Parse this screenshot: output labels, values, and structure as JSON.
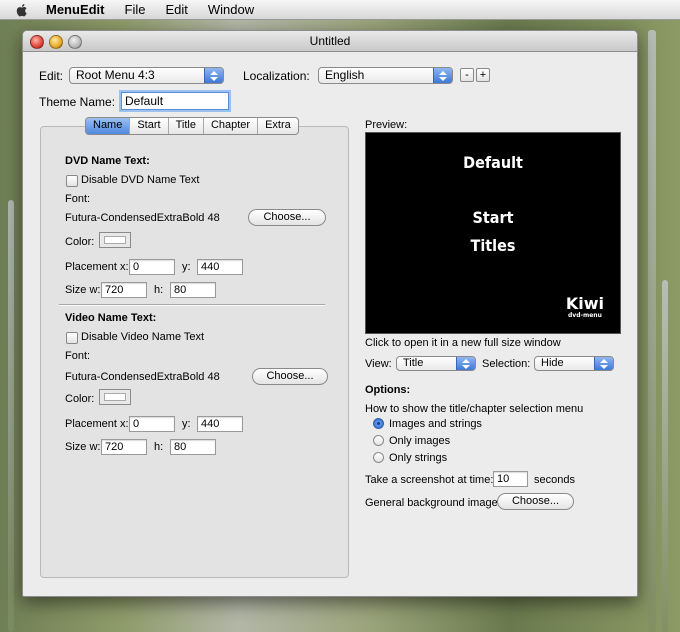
{
  "menubar": {
    "app": "MenuEdit",
    "items": [
      "File",
      "Edit",
      "Window"
    ]
  },
  "window": {
    "title": "Untitled"
  },
  "edit": {
    "label": "Edit:",
    "value": "Root Menu 4:3"
  },
  "localization": {
    "label": "Localization:",
    "value": "English",
    "minus": "-",
    "plus": "+"
  },
  "theme": {
    "label": "Theme Name:",
    "value": "Default"
  },
  "tabs": [
    {
      "label": "Name",
      "active": true
    },
    {
      "label": "Start"
    },
    {
      "label": "Title"
    },
    {
      "label": "Chapter"
    },
    {
      "label": "Extra"
    }
  ],
  "dvd": {
    "heading": "DVD Name Text:",
    "disable": "Disable DVD Name Text",
    "font_label": "Font:",
    "font": "Futura-CondensedExtraBold 48",
    "choose": "Choose...",
    "color_label": "Color:",
    "placement_label": "Placement x:",
    "x": "0",
    "y_label": "y:",
    "y": "440",
    "size_label": "Size w:",
    "w": "720",
    "h_label": "h:",
    "h": "80"
  },
  "video": {
    "heading": "Video Name Text:",
    "disable": "Disable Video Name Text",
    "font_label": "Font:",
    "font": "Futura-CondensedExtraBold 48",
    "choose": "Choose...",
    "color_label": "Color:",
    "placement_label": "Placement x:",
    "x": "0",
    "y_label": "y:",
    "y": "440",
    "size_label": "Size w:",
    "w": "720",
    "h_label": "h:",
    "h": "80"
  },
  "preview": {
    "label": "Preview:",
    "lines": [
      "Default",
      "Start",
      "Titles"
    ],
    "logo": "Kiwi",
    "logo_sub": "dvd-menu",
    "hint": "Click to open it in a new full size window"
  },
  "view": {
    "label": "View:",
    "value": "Title",
    "selection_label": "Selection:",
    "selection_value": "Hide"
  },
  "options": {
    "heading": "Options:",
    "question": "How to show the title/chapter selection menu",
    "radios": [
      "Images and strings",
      "Only images",
      "Only strings"
    ],
    "selected_index": 0,
    "screenshot_label": "Take a screenshot at time:",
    "screenshot_value": "10",
    "seconds": "seconds",
    "bg_label": "General background image:",
    "bg_choose": "Choose..."
  }
}
